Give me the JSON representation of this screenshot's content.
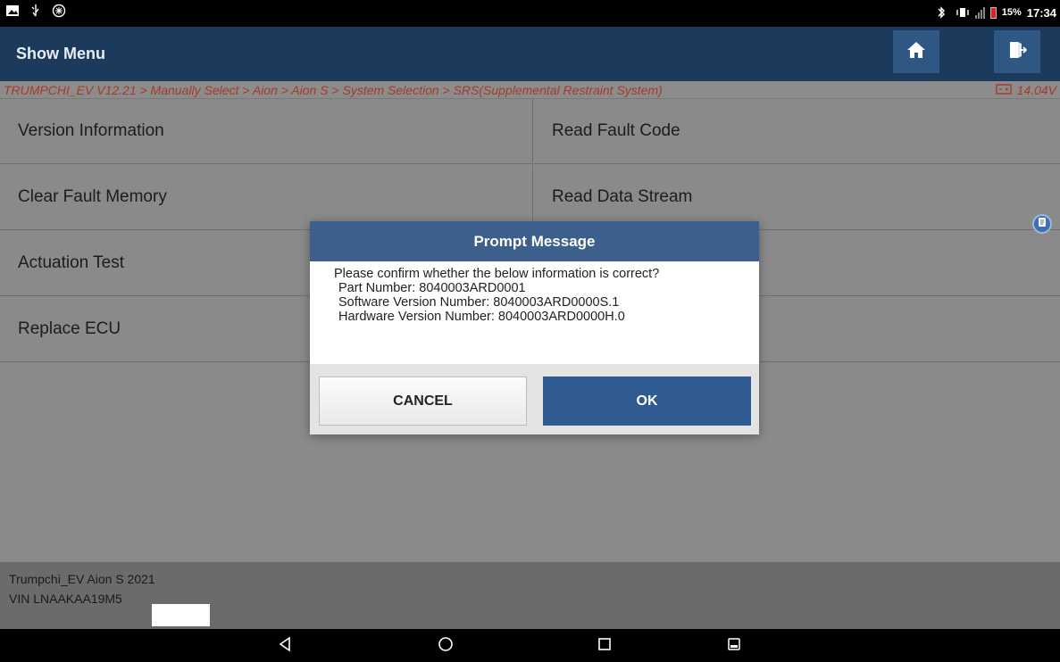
{
  "status_bar": {
    "battery_percent": "15%",
    "time": "17:34",
    "icons": [
      "image-icon",
      "usb-icon",
      "settings-bubble-icon",
      "bluetooth-icon",
      "vibrate-icon",
      "signal-icon",
      "battery-icon"
    ]
  },
  "header": {
    "title": "Show Menu",
    "home_icon": "home-icon",
    "exit_icon": "exit-icon"
  },
  "breadcrumb": {
    "path": "TRUMPCHI_EV V12.21 > Manually Select > Aion > Aion S > System Selection > SRS(Supplemental Restraint System)",
    "voltage": "14.04V",
    "voltage_icon": "car-battery-icon"
  },
  "menu": {
    "items": [
      {
        "label": "Version Information"
      },
      {
        "label": "Read Fault Code"
      },
      {
        "label": "Clear Fault Memory"
      },
      {
        "label": "Read Data Stream"
      },
      {
        "label": "Actuation Test"
      },
      {
        "label": ""
      },
      {
        "label": "Replace ECU"
      },
      {
        "label": ""
      }
    ]
  },
  "dialog": {
    "title": "Prompt Message",
    "lines": [
      "Please confirm whether the below information is correct?",
      "Part Number: 8040003ARD0001",
      "Software Version Number: 8040003ARD0000S.1",
      "Hardware Version Number: 8040003ARD0000H.0"
    ],
    "cancel_label": "CANCEL",
    "ok_label": "OK"
  },
  "footer": {
    "vehicle": "Trumpchi_EV Aion S 2021",
    "vin": "VIN LNAAKAA19M5"
  },
  "nav": {
    "icons": [
      "back-icon",
      "home-circle-icon",
      "recents-icon",
      "screenshot-icon"
    ]
  },
  "colors": {
    "header_bg": "#1c3a5c",
    "header_button": "#2e5784",
    "dialog_header": "#3d5f8c",
    "ok_button": "#2f5b92",
    "breadcrumb_text": "#a53a2a"
  }
}
